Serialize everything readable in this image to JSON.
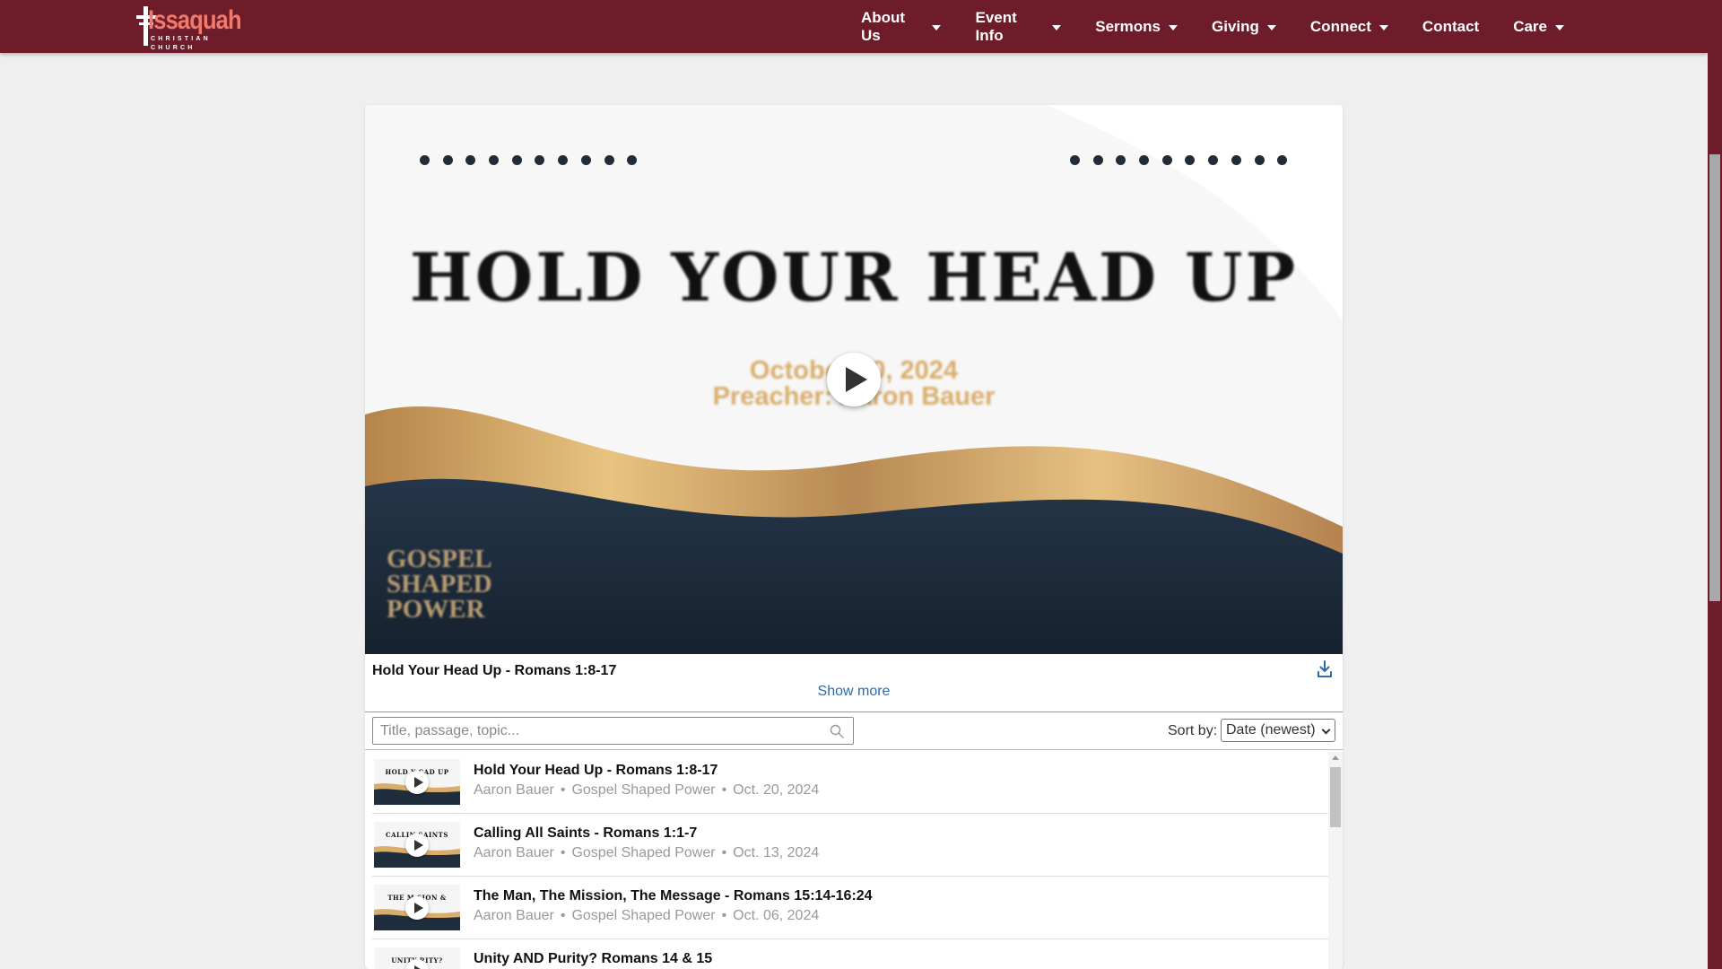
{
  "nav": {
    "logo_main": "Issaquah",
    "logo_sub": "CHRISTIAN CHURCH",
    "items": [
      {
        "label": "About Us",
        "dropdown": true
      },
      {
        "label": "Event Info",
        "dropdown": true
      },
      {
        "label": "Sermons",
        "dropdown": true
      },
      {
        "label": "Giving",
        "dropdown": true
      },
      {
        "label": "Connect",
        "dropdown": true
      },
      {
        "label": "Contact",
        "dropdown": false
      },
      {
        "label": "Care",
        "dropdown": true
      }
    ]
  },
  "colors": {
    "brand": "#6e1b2a",
    "logo_accent": "#f07a6c",
    "link": "#2d6aa8",
    "gold": "#d9ad6c",
    "navy": "#1b2a3a"
  },
  "player": {
    "video_title": "HOLD YOUR HEAD UP",
    "video_date": "October 20, 2024",
    "video_preacher": "Preacher: Aaron Bauer",
    "series_logo": [
      "GOSPEL",
      "SHAPED",
      "POWER"
    ],
    "now_playing_title": "Hold Your Head Up - Romans 1:8-17",
    "download_icon": "download-icon",
    "show_more": "Show more"
  },
  "search": {
    "placeholder": "Title, passage, topic...",
    "value": "",
    "icon": "search-icon"
  },
  "sort": {
    "label": "Sort by:",
    "selected": "Date (newest)"
  },
  "sermons": [
    {
      "title": "Hold Your Head Up - Romans 1:8-17",
      "thumb_text": "HOLD Y   CAD UP",
      "preacher": "Aaron Bauer",
      "series": "Gospel Shaped Power",
      "date": "Oct. 20, 2024"
    },
    {
      "title": "Calling All Saints - Romans 1:1-7",
      "thumb_text": "CALLIN   SAINTS",
      "preacher": "Aaron Bauer",
      "series": "Gospel Shaped Power",
      "date": "Oct. 13, 2024"
    },
    {
      "title": "The Man, The Mission, The Message - Romans 15:14-16:24",
      "thumb_text": "THE M   SION &",
      "preacher": "Aaron Bauer",
      "series": "Gospel Shaped Power",
      "date": "Oct. 06, 2024"
    },
    {
      "title": "Unity AND Purity? Romans 14 & 15",
      "thumb_text": "UNITY   RITY?",
      "preacher": "",
      "series": "",
      "date": ""
    }
  ]
}
